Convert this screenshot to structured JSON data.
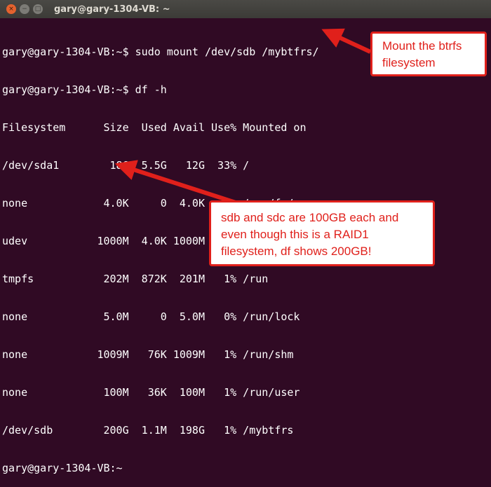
{
  "window": {
    "title": "gary@gary-1304-VB: ~",
    "close_glyph": "×",
    "minimize_glyph": "−",
    "maximize_glyph": "□"
  },
  "terminal": {
    "lines": [
      "gary@gary-1304-VB:~$ sudo mount /dev/sdb /mybtfrs/",
      "gary@gary-1304-VB:~$ df -h",
      "Filesystem      Size  Used Avail Use% Mounted on",
      "/dev/sda1        18G  5.5G   12G  33% /",
      "none            4.0K     0  4.0K   0% /sys/fs/cgroup",
      "udev           1000M  4.0K 1000M   1% /dev",
      "tmpfs           202M  872K  201M   1% /run",
      "none            5.0M     0  5.0M   0% /run/lock",
      "none           1009M   76K 1009M   1% /run/shm",
      "none            100M   36K  100M   1% /run/user",
      "/dev/sdb        200G  1.1M  198G   1% /mybtfrs",
      "gary@gary-1304-VB:~"
    ]
  },
  "annotations": {
    "mount": "Mount the btrfs filesystem",
    "df": "sdb and sdc are 100GB each and even though this is a RAID1 filesystem, df shows 200GB!"
  },
  "colors": {
    "terminal_bg": "#300a24",
    "annotation_red": "#e0201b"
  }
}
